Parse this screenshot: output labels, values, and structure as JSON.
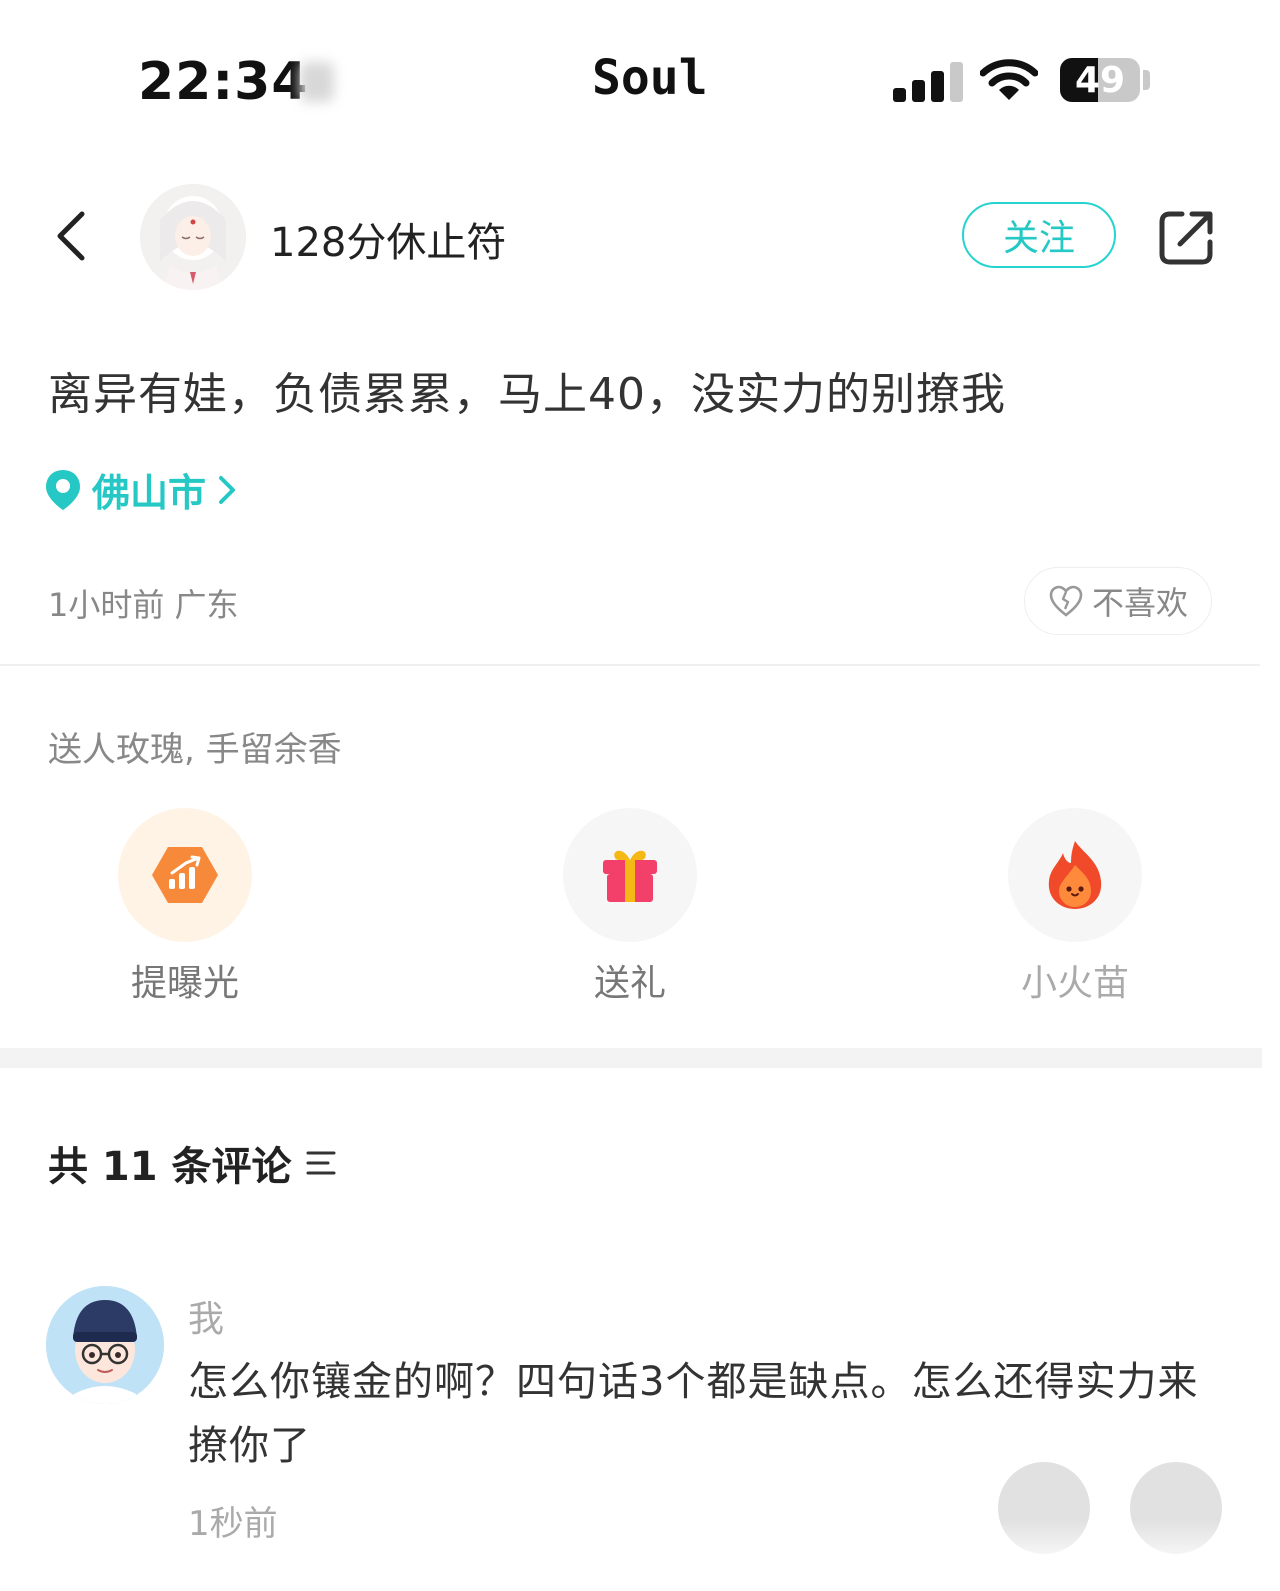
{
  "status_bar": {
    "time": "22:34",
    "app_name": "Soul",
    "battery": "49",
    "icons": [
      "signal-icon",
      "wifi-icon",
      "battery-icon"
    ]
  },
  "header": {
    "back_icon": "chevron-left-icon",
    "username": "128分休止符",
    "follow_label": "关注",
    "share_icon": "share-icon"
  },
  "post": {
    "text": "离异有娃，负债累累，马上40，没实力的别撩我",
    "location": "佛山市",
    "meta": "1小时前 广东",
    "dislike_label": "不喜欢"
  },
  "gifts": {
    "prompt": "送人玫瑰, 手留余香",
    "actions": [
      {
        "label": "提曝光",
        "icon": "boost-icon"
      },
      {
        "label": "送礼",
        "icon": "gift-icon"
      },
      {
        "label": "小火苗",
        "icon": "flame-icon"
      }
    ]
  },
  "comments": {
    "header": "共 11 条评论",
    "items": [
      {
        "author": "我",
        "text": "怎么你镶金的啊？四句话3个都是缺点。怎么还得实力来撩你了",
        "time": "1秒前"
      }
    ]
  },
  "colors": {
    "accent": "#25c8c4",
    "boost": "#f7893a",
    "gift": "#f2406a",
    "flame": "#f04a2a"
  }
}
